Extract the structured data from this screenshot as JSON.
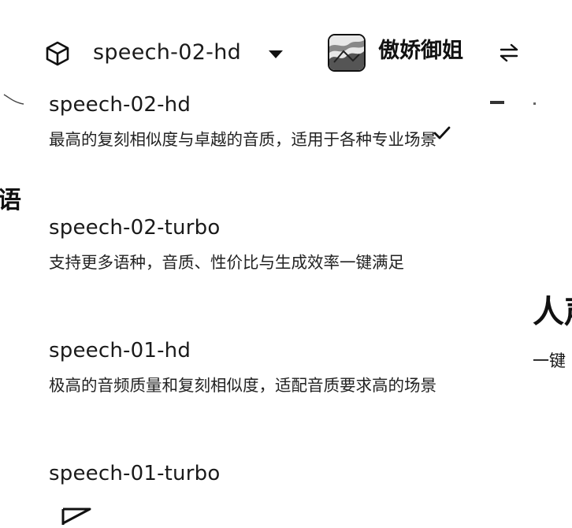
{
  "toolbar": {
    "model_select_label": "speech-02-hd",
    "voice_name": "傲娇御姐"
  },
  "background": {
    "lang_fragment": "语",
    "heading_fragment": "人声",
    "sub_fragment": "一键"
  },
  "model_options": [
    {
      "name": "speech-02-hd",
      "description": "最高的复刻相似度与卓越的音质，适用于各种专业场景",
      "selected": true
    },
    {
      "name": "speech-02-turbo",
      "description": "支持更多语种，音质、性价比与生成效率一键满足",
      "selected": false
    },
    {
      "name": "speech-01-hd",
      "description": "极高的音频质量和复刻相似度，适配音质要求高的场景",
      "selected": false
    },
    {
      "name": "speech-01-turbo",
      "description": "",
      "selected": false
    }
  ],
  "icons": {
    "model": "cube-icon",
    "dropdown": "caret-down-icon",
    "swap": "swap-arrows-icon",
    "selected": "check-icon"
  }
}
